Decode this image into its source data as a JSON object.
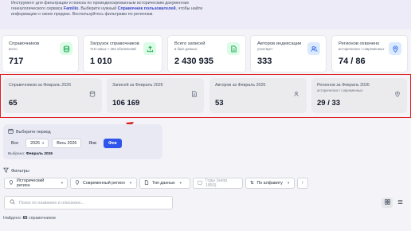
{
  "intro": {
    "line1": "Инструмент для фильтрации и поиска по проиндексированным историческим документам",
    "line2_prefix": "генеалогического сервиса ",
    "line2_brand": "Familio",
    "line2_mid": ". Выберите нужный ",
    "line2_link": "Справочник пользователей",
    "line2_suffix": ", чтобы найти",
    "line3": "информацию о своих предках. Воспользуйтесь фильтрами по регионам."
  },
  "stats": [
    {
      "label": "Справочников",
      "sub": "всего",
      "value": "717",
      "icon": "database-icon",
      "color": "#16a34a",
      "bg": "#dcfce7"
    },
    {
      "label": "Загрузок справочников",
      "sub": "716 новых + 262 обновлений",
      "value": "1 010",
      "icon": "upload-icon",
      "color": "#16a34a",
      "bg": "#dcfce7"
    },
    {
      "label": "Всего записей",
      "sub": "в базе данных",
      "value": "2 430 935",
      "icon": "document-icon",
      "color": "#16a34a",
      "bg": "#dcfce7"
    },
    {
      "label": "Авторов индексации",
      "sub": "участвует",
      "value": "333",
      "icon": "users-icon",
      "color": "#2563eb",
      "bg": "#dbeafe"
    },
    {
      "label": "Регионов охвачено",
      "sub": "исторических / современных",
      "value": "74 / 86",
      "icon": "map-pin-icon",
      "color": "#2563eb",
      "bg": "#dbeafe"
    }
  ],
  "feb": [
    {
      "label": "Справочников за Февраль 2026",
      "sub": "",
      "value": "65",
      "icon": "database-icon"
    },
    {
      "label": "Записей за Февраль 2026",
      "sub": "",
      "value": "106 169",
      "icon": "document-icon"
    },
    {
      "label": "Авторов за Февраль 2026",
      "sub": "",
      "value": "53",
      "icon": "users-icon"
    },
    {
      "label": "Регионов за Февраль 2026",
      "sub": "исторических / современных",
      "value": "29 / 33",
      "icon": "map-pin-icon"
    }
  ],
  "period": {
    "title": "Выберите период",
    "all": "Все",
    "year": "2026",
    "whole_year": "Весь 2026",
    "jan": "Янв",
    "feb": "Фев",
    "chosen_prefix": "Выбрано:",
    "chosen_value": "Февраль 2026"
  },
  "filters": {
    "title": "Фильтры",
    "historical_region": "Исторический регион",
    "modern_region": "Современный регион",
    "data_type": "Тип данных",
    "years_placeholder": "Годы (напр. 1850)",
    "sort": "По алфавиту"
  },
  "search": {
    "placeholder": "Поиск по названию и описанию..."
  },
  "found": {
    "prefix": "Найдено:",
    "count": "65",
    "suffix": "справочников"
  }
}
